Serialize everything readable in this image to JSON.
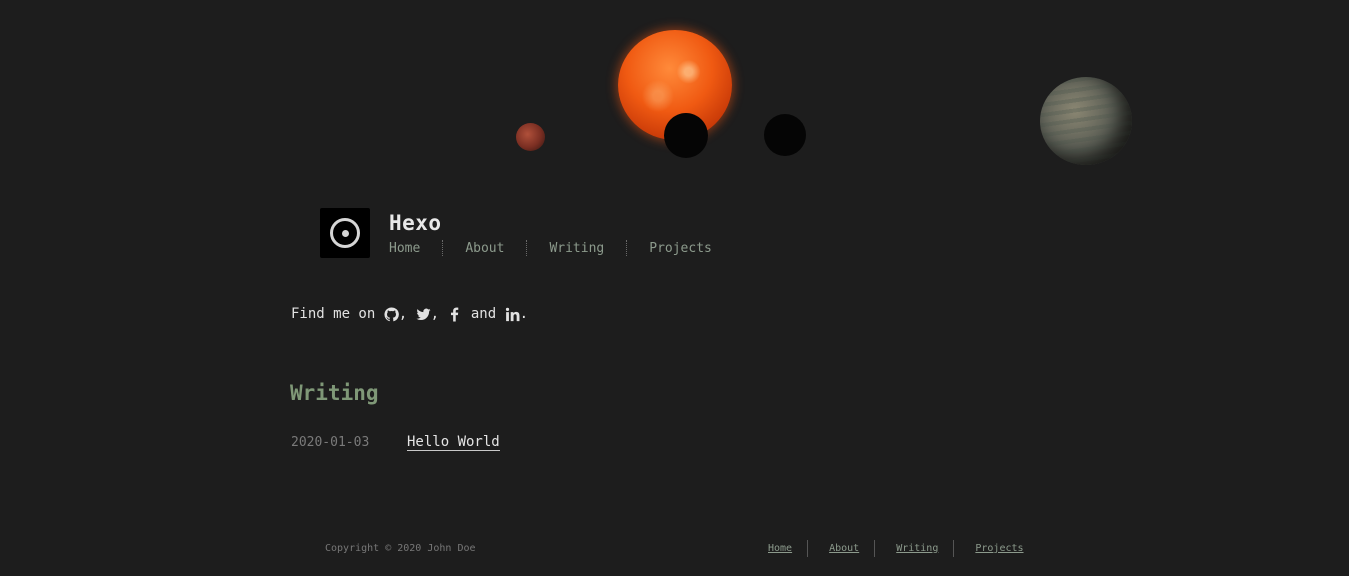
{
  "site": {
    "title": "Hexo"
  },
  "nav": {
    "items": [
      {
        "label": "Home"
      },
      {
        "label": "About"
      },
      {
        "label": "Writing"
      },
      {
        "label": "Projects"
      }
    ]
  },
  "intro": {
    "prefix": "Find me on ",
    "comma_1": ", ",
    "comma_2": ", ",
    "and": " and ",
    "period": ".",
    "icons": [
      "github-icon",
      "twitter-icon",
      "facebook-icon",
      "linkedin-icon"
    ]
  },
  "writing": {
    "heading": "Writing",
    "posts": [
      {
        "date": "2020-01-03",
        "title": "Hello World"
      }
    ]
  },
  "footer": {
    "copyright": "Copyright © 2020 John Doe",
    "nav": [
      {
        "label": "Home"
      },
      {
        "label": "About"
      },
      {
        "label": "Writing"
      },
      {
        "label": "Projects"
      }
    ]
  },
  "colors": {
    "background": "#1d1d1d",
    "accent": "#7f9877",
    "nav_link": "#8c9a8c",
    "sun": "#f05a12"
  }
}
